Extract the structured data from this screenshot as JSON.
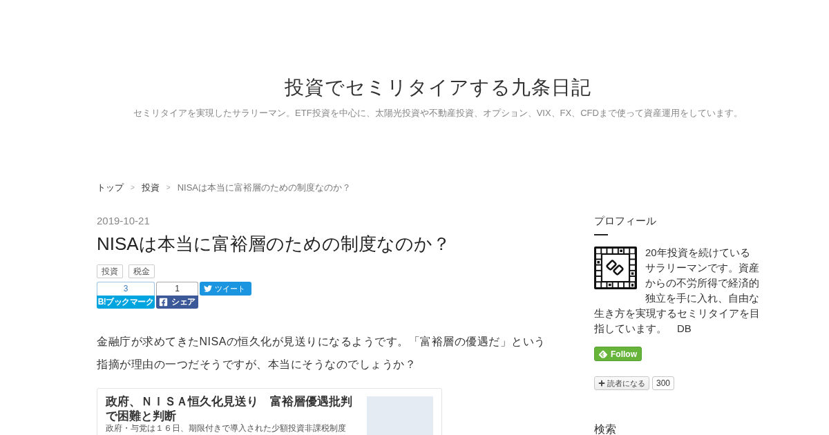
{
  "blog": {
    "title": "投資でセミリタイアする九条日記",
    "description": "セミリタイアを実現したサラリーマン。ETF投資を中心に、太陽光投資や不動産投資、オプション、VIX、FX、CFDまで使って資産運用をしています。"
  },
  "breadcrumb": [
    {
      "label": "トップ",
      "current": false,
      "separator": ">"
    },
    {
      "label": "投資",
      "current": false,
      "separator": ">"
    },
    {
      "label": "NISAは本当に富裕層のための制度なのか？",
      "current": true
    }
  ],
  "article": {
    "date": "2019-10-21",
    "title": "NISAは本当に富裕層のための制度なのか？",
    "categories": [
      "投資",
      "税金"
    ],
    "share": [
      {
        "kind": "hatena",
        "count": "3",
        "label": "B!ブックマーク"
      },
      {
        "kind": "facebook",
        "count": "1",
        "label": "シェア"
      },
      {
        "kind": "twitter",
        "label": "ツイート"
      }
    ],
    "body": [
      "金融庁が求めてきたNISAの恒久化が見送りになるようです。「富裕層の優遇だ」という指摘が理由の一つだそうですが、本当にそうなのでしょうか？"
    ],
    "embed": {
      "title": "政府、ＮＩＳＡ恒久化見送り　富裕層優遇批判で困難と判断",
      "description": "政府・与党は１６日、期限付きで導入された少額投資非課税制度"
    }
  },
  "sidebar": {
    "profile": {
      "heading": "プロフィール",
      "text": [
        "20年投資を続けているサラリーマンです。資産からの不労所得で経済的独立を手に入れ、自由な",
        "生き方を実現するセミリタイアを目指しています。　DB"
      ]
    },
    "follow_button": {
      "label": "Follow"
    },
    "subscribe": {
      "label": "読者になる",
      "count": "300"
    },
    "search": {
      "heading": "検索"
    }
  }
}
